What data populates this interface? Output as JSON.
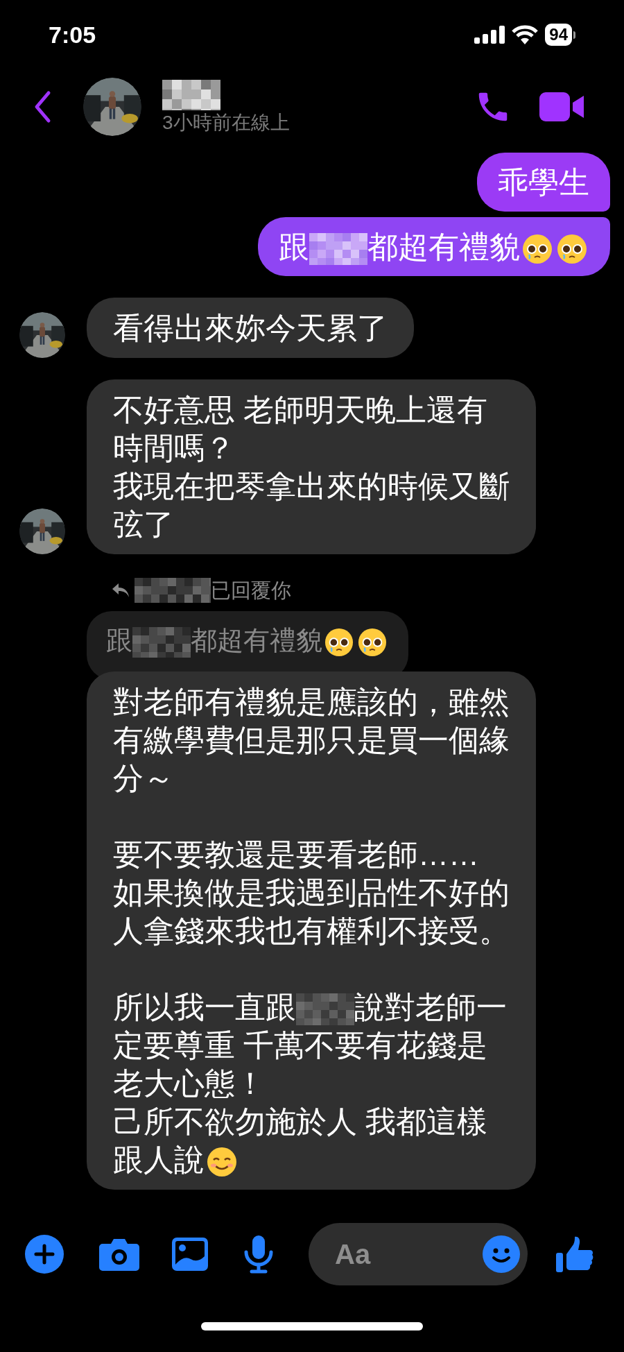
{
  "status_bar": {
    "time": "7:05",
    "battery": "94"
  },
  "header": {
    "name": [
      {
        "kind": "redacted"
      }
    ],
    "subtitle": "3小時前在線上"
  },
  "messages": [
    {
      "kind": "sent",
      "parts": [
        {
          "kind": "text",
          "text": "乖學生"
        }
      ]
    },
    {
      "kind": "sent",
      "parts": [
        {
          "kind": "text",
          "text": "跟"
        },
        {
          "kind": "redacted"
        },
        {
          "kind": "text",
          "text": "都超有禮貌"
        },
        {
          "kind": "emoji_pleading"
        },
        {
          "kind": "emoji_pleading"
        }
      ]
    },
    {
      "kind": "received",
      "show_avatar": true,
      "parts": [
        {
          "kind": "text",
          "text": "看得出來妳今天累了"
        }
      ]
    },
    {
      "kind": "received",
      "show_avatar": true,
      "parts": [
        {
          "kind": "text",
          "text": "不好意思 老師明天晚上還有時間嗎？"
        },
        {
          "kind": "line_break"
        },
        {
          "kind": "text",
          "text": "我現在把琴拿出來的時候又斷弦了"
        }
      ]
    },
    {
      "kind": "reply_note",
      "parts": [
        {
          "kind": "redacted"
        },
        {
          "kind": "text",
          "text": "已回覆你"
        }
      ]
    },
    {
      "kind": "quoted",
      "parts": [
        {
          "kind": "text",
          "text": "跟"
        },
        {
          "kind": "redacted"
        },
        {
          "kind": "text",
          "text": "都超有禮貌"
        },
        {
          "kind": "emoji_pleading"
        },
        {
          "kind": "emoji_pleading"
        }
      ]
    },
    {
      "kind": "received",
      "show_avatar": false,
      "parts": [
        {
          "kind": "text",
          "text": "對老師有禮貌是應該的，雖然有繳學費但是那只是買一個緣分～"
        },
        {
          "kind": "paragraph_break"
        },
        {
          "kind": "text",
          "text": "要不要教還是要看老師……"
        },
        {
          "kind": "line_break"
        },
        {
          "kind": "text",
          "text": "如果換做是我遇到品性不好的人拿錢來我也有權利不接受。"
        },
        {
          "kind": "paragraph_break"
        },
        {
          "kind": "text",
          "text": "所以我一直跟"
        },
        {
          "kind": "redacted"
        },
        {
          "kind": "text",
          "text": "說對老師一定要尊重 千萬不要有花錢是老大心態！"
        },
        {
          "kind": "line_break"
        },
        {
          "kind": "text",
          "text": "己所不欲勿施於人 我都這樣跟人說"
        },
        {
          "kind": "emoji_smiling"
        }
      ]
    }
  ],
  "composer": {
    "placeholder": "Aa"
  }
}
